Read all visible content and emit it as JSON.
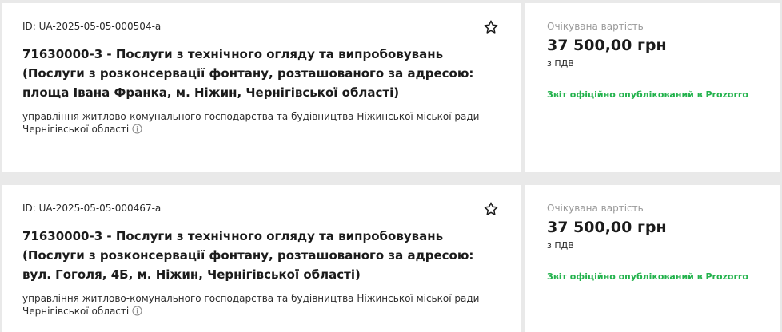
{
  "tenders": [
    {
      "id_text": "ID: UA-2025-05-05-000504-a",
      "title": "71630000-3 - Послуги з технічного огляду та випробовувань (Послуги з розконсервації фонтану, розташованого за адресою: площа Івана Франка, м. Ніжин, Чернігівської області)",
      "organization": "управління житлово-комунального господарства та будівництва Ніжинської міської ради Чернігівської області",
      "price_label": "Очікувана вартість",
      "price": "37 500,00 грн",
      "vat": "з ПДВ",
      "status": "Звіт офіційно опублікований в Prozorro"
    },
    {
      "id_text": "ID: UA-2025-05-05-000467-a",
      "title": "71630000-3 - Послуги з технічного огляду та випробовувань (Послуги з розконсервації фонтану, розташованого за адресою: вул. Гоголя, 4Б, м. Ніжин, Чернігівської області)",
      "organization": "управління житлово-комунального господарства та будівництва Ніжинської міської ради Чернігівської області",
      "price_label": "Очікувана вартість",
      "price": "37 500,00 грн",
      "vat": "з ПДВ",
      "status": "Звіт офіційно опублікований в Prozorro"
    }
  ],
  "icons": {
    "favorite": "star-outline-icon",
    "info": "info-circle-icon"
  },
  "colors": {
    "status": "#22b24c",
    "muted_label": "#9a9a9a",
    "background": "#e9e9e9"
  }
}
